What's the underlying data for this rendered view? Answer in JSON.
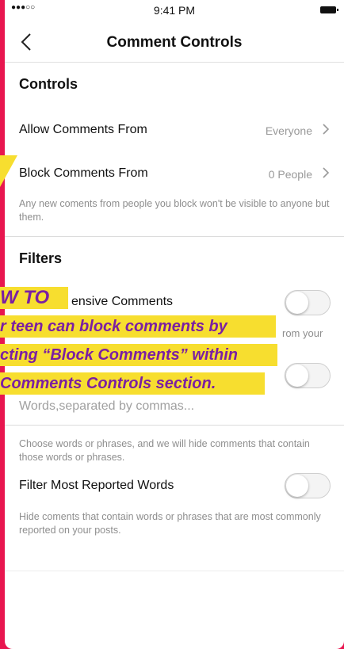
{
  "status": {
    "time": "9:41 PM",
    "signal": "●●●○○"
  },
  "nav": {
    "title": "Comment Controls"
  },
  "controls": {
    "heading": "Controls",
    "allow_label": "Allow Comments From",
    "allow_value": "Everyone",
    "block_label": "Block Comments From",
    "block_value": "0 People",
    "block_help": "Any new coments from people you block won't be visible to anyone but them."
  },
  "filters": {
    "heading": "Filters",
    "hide_offensive_fragment": "ensive Comments",
    "hide_offensive_help_fragment": "rom your",
    "manual_placeholder": "Words,separated by commas...",
    "manual_help": "Choose words or phrases, and we will hide comments that contain those words or phrases.",
    "reported_label": "Filter Most Reported Words",
    "reported_help": "Hide coments that contain words or phrases that are most commonly reported on your posts."
  },
  "overlay": {
    "line1": "W TO",
    "line2": "r teen can block comments by",
    "line3": "cting “Block Comments” within",
    "line4": "Comments Controls section."
  },
  "colors": {
    "background": "#e8164f",
    "highlight": "#f7de2f",
    "overlay_text": "#7b1fa2"
  }
}
